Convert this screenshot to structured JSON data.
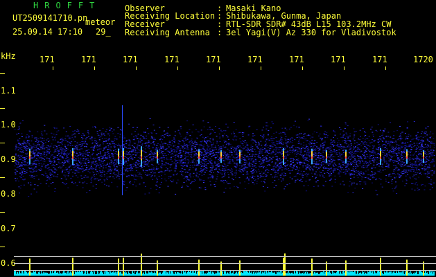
{
  "header": {
    "brand": "HROFFT",
    "filename": "UT2509141710.pn",
    "meteor_label": "meteor",
    "datetime": "25.09.14 17:10",
    "count": "29_"
  },
  "info": {
    "labels": [
      "Observer",
      "Receiving Location",
      "Receiver",
      "Receiving Antenna"
    ],
    "colons": [
      ":",
      ":",
      ":",
      ":"
    ],
    "values": [
      "Masaki Kano",
      "Shibukawa, Gunma, Japan",
      "RTL-SDR SDR# 43dB L15 103.2MHz CW",
      "3el Yagi(V) Az 330 for Vladivostok"
    ]
  },
  "axis": {
    "unit": "kHz",
    "y_ticks": [
      "1.1",
      "1.0",
      "0.9",
      "0.8",
      "0.7",
      "0.6"
    ],
    "x_ticks": [
      "171",
      "171",
      "171",
      "171",
      "171",
      "171",
      "171",
      "171",
      "171",
      "1720"
    ]
  },
  "colors": {
    "text_green": "#2fd640",
    "text_yellow": "#ffff3a",
    "background": "#000000",
    "baseline_cyan": "#00e8ff"
  }
}
